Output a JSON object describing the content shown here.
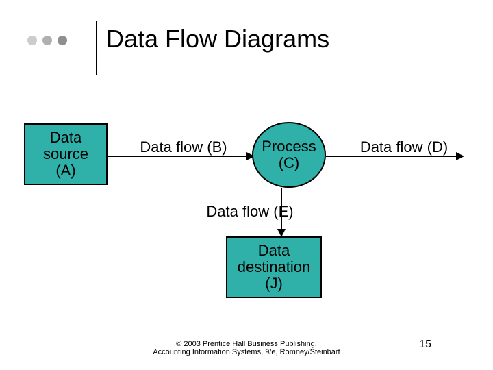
{
  "title": "Data Flow Diagrams",
  "nodes": {
    "source": {
      "line1": "Data",
      "line2": "source",
      "line3": "(A)"
    },
    "process": {
      "line1": "Process",
      "line2": "(C)"
    },
    "destination": {
      "line1": "Data",
      "line2": "destination",
      "line3": "(J)"
    }
  },
  "flows": {
    "b": "Data flow (B)",
    "d": "Data flow (D)",
    "e": "Data flow (E)"
  },
  "footer": {
    "line1": "© 2003 Prentice Hall Business Publishing,",
    "line2": "Accounting Information Systems, 9/e, Romney/Steinbart"
  },
  "page_number": "15"
}
